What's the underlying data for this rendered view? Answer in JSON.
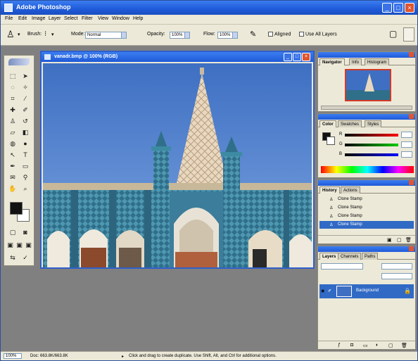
{
  "window": {
    "title": "Adobe Photoshop"
  },
  "menu": [
    "File",
    "Edit",
    "Image",
    "Layer",
    "Select",
    "Filter",
    "View",
    "Window",
    "Help"
  ],
  "options": {
    "brush_label": "Brush:",
    "mode_label": "Mode:",
    "mode_value": "Normal",
    "opacity_label": "Opacity:",
    "opacity_value": "100%",
    "flow_label": "Flow:",
    "flow_value": "100%",
    "aligned_label": "Aligned",
    "use_all_layers_label": "Use All Layers"
  },
  "document": {
    "title": "vanadr.bmp @ 100% (RGB)"
  },
  "navigator": {
    "tabs": [
      "Navigator",
      "Info",
      "Histogram"
    ]
  },
  "color": {
    "tabs": [
      "Color",
      "Swatches",
      "Styles"
    ],
    "channels": [
      "R",
      "G",
      "B"
    ]
  },
  "history": {
    "tabs": [
      "History",
      "Actions"
    ],
    "items": [
      "Clone Stamp",
      "Clone Stamp",
      "Clone Stamp",
      "Clone Stamp"
    ]
  },
  "layers": {
    "tabs": [
      "Layers",
      "Channels",
      "Paths"
    ],
    "layer_name": "Background"
  },
  "status": {
    "zoom": "100%",
    "doc": "Doc: 663.8K/663.8K",
    "hint": "Click and drag to create duplicate. Use Shift, Alt, and Ctrl for additional options."
  },
  "colors": {
    "title_blue": "#1f5ad8",
    "panel_bg": "#ece9d8",
    "workspace": "#808080",
    "selected_layer": "#316ac5"
  }
}
